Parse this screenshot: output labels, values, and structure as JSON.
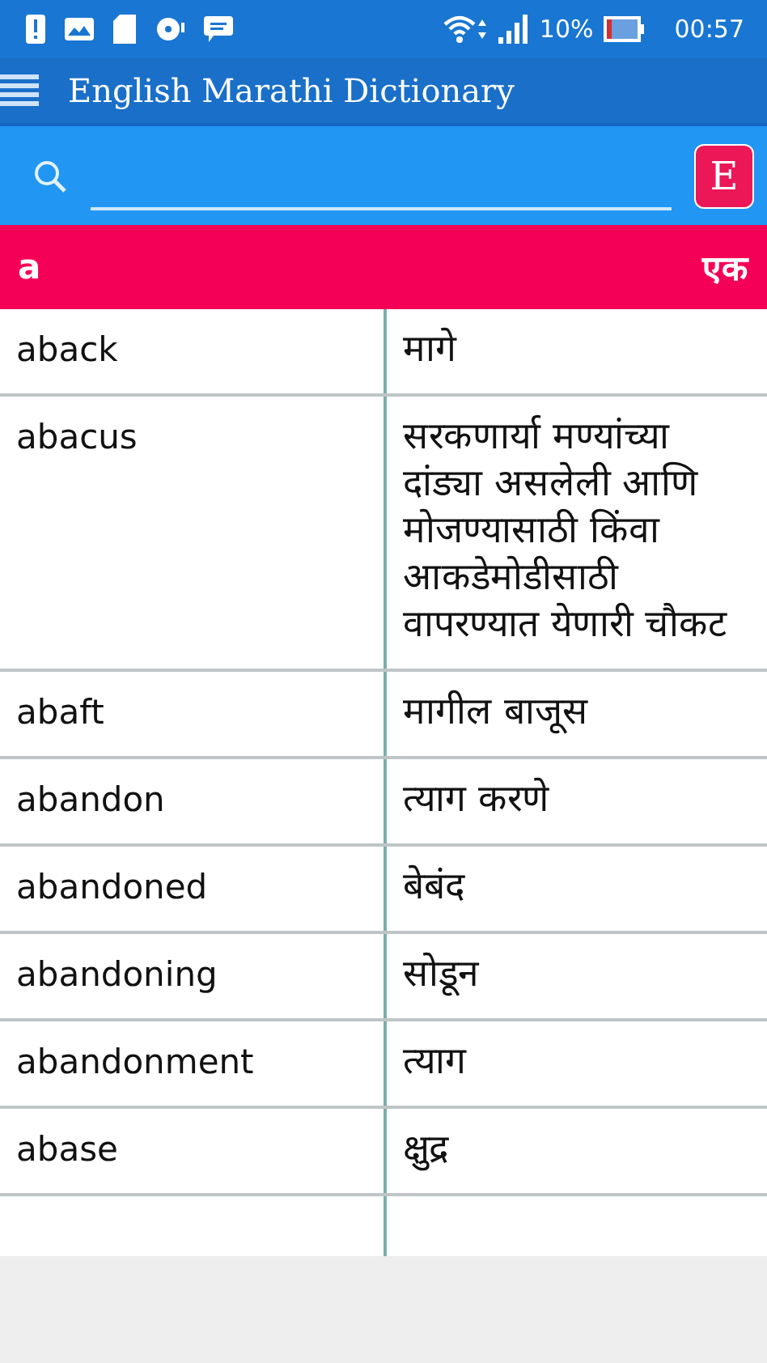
{
  "status_bar": {
    "battery": "10%",
    "time": "00:57"
  },
  "app_bar": {
    "title": "English Marathi Dictionary"
  },
  "search": {
    "language_button": "E"
  },
  "header": {
    "word": "a",
    "meaning": "एक"
  },
  "rows": [
    {
      "word": "aback",
      "meaning": "मागे"
    },
    {
      "word": "abacus",
      "meaning": "सरकणार्या मण्यांच्या दांड्या असलेली आणि मोजण्यासाठी किंवा आकडेमोडीसाठी वापरण्यात येणारी चौकट"
    },
    {
      "word": "abaft",
      "meaning": "मागील बाजूस"
    },
    {
      "word": "abandon",
      "meaning": "त्याग करणे"
    },
    {
      "word": "abandoned",
      "meaning": "बेबंद"
    },
    {
      "word": "abandoning",
      "meaning": "सोडून"
    },
    {
      "word": "abandonment",
      "meaning": "त्याग"
    },
    {
      "word": "abase",
      "meaning": "क्षुद्र"
    }
  ]
}
